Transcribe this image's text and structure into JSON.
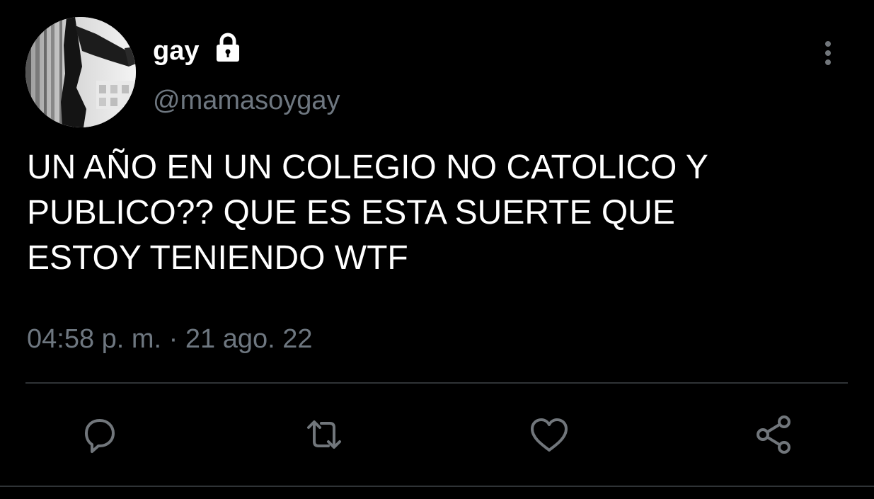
{
  "tweet": {
    "author": {
      "display_name": "gay",
      "handle": "@mamasoygay",
      "protected_icon": "lock-icon",
      "avatar": "grayscale-photo-avatar"
    },
    "text": "UN AÑO EN UN COLEGIO NO CATOLICO Y\nPUBLICO?? QUE ES ESTA SUERTE QUE\nESTOY TENIENDO WTF",
    "timestamp": "04:58 p. m. · 21 ago. 22",
    "menu_icon": "more-vertical-icon",
    "actions": [
      {
        "name": "reply",
        "icon": "reply-icon"
      },
      {
        "name": "retweet",
        "icon": "retweet-icon"
      },
      {
        "name": "like",
        "icon": "heart-icon"
      },
      {
        "name": "share",
        "icon": "share-icon"
      }
    ]
  },
  "colors": {
    "background": "#000000",
    "primary_text": "#ffffff",
    "secondary_text": "#6e7780",
    "divider": "#2f3336",
    "icon": "#71767b"
  }
}
